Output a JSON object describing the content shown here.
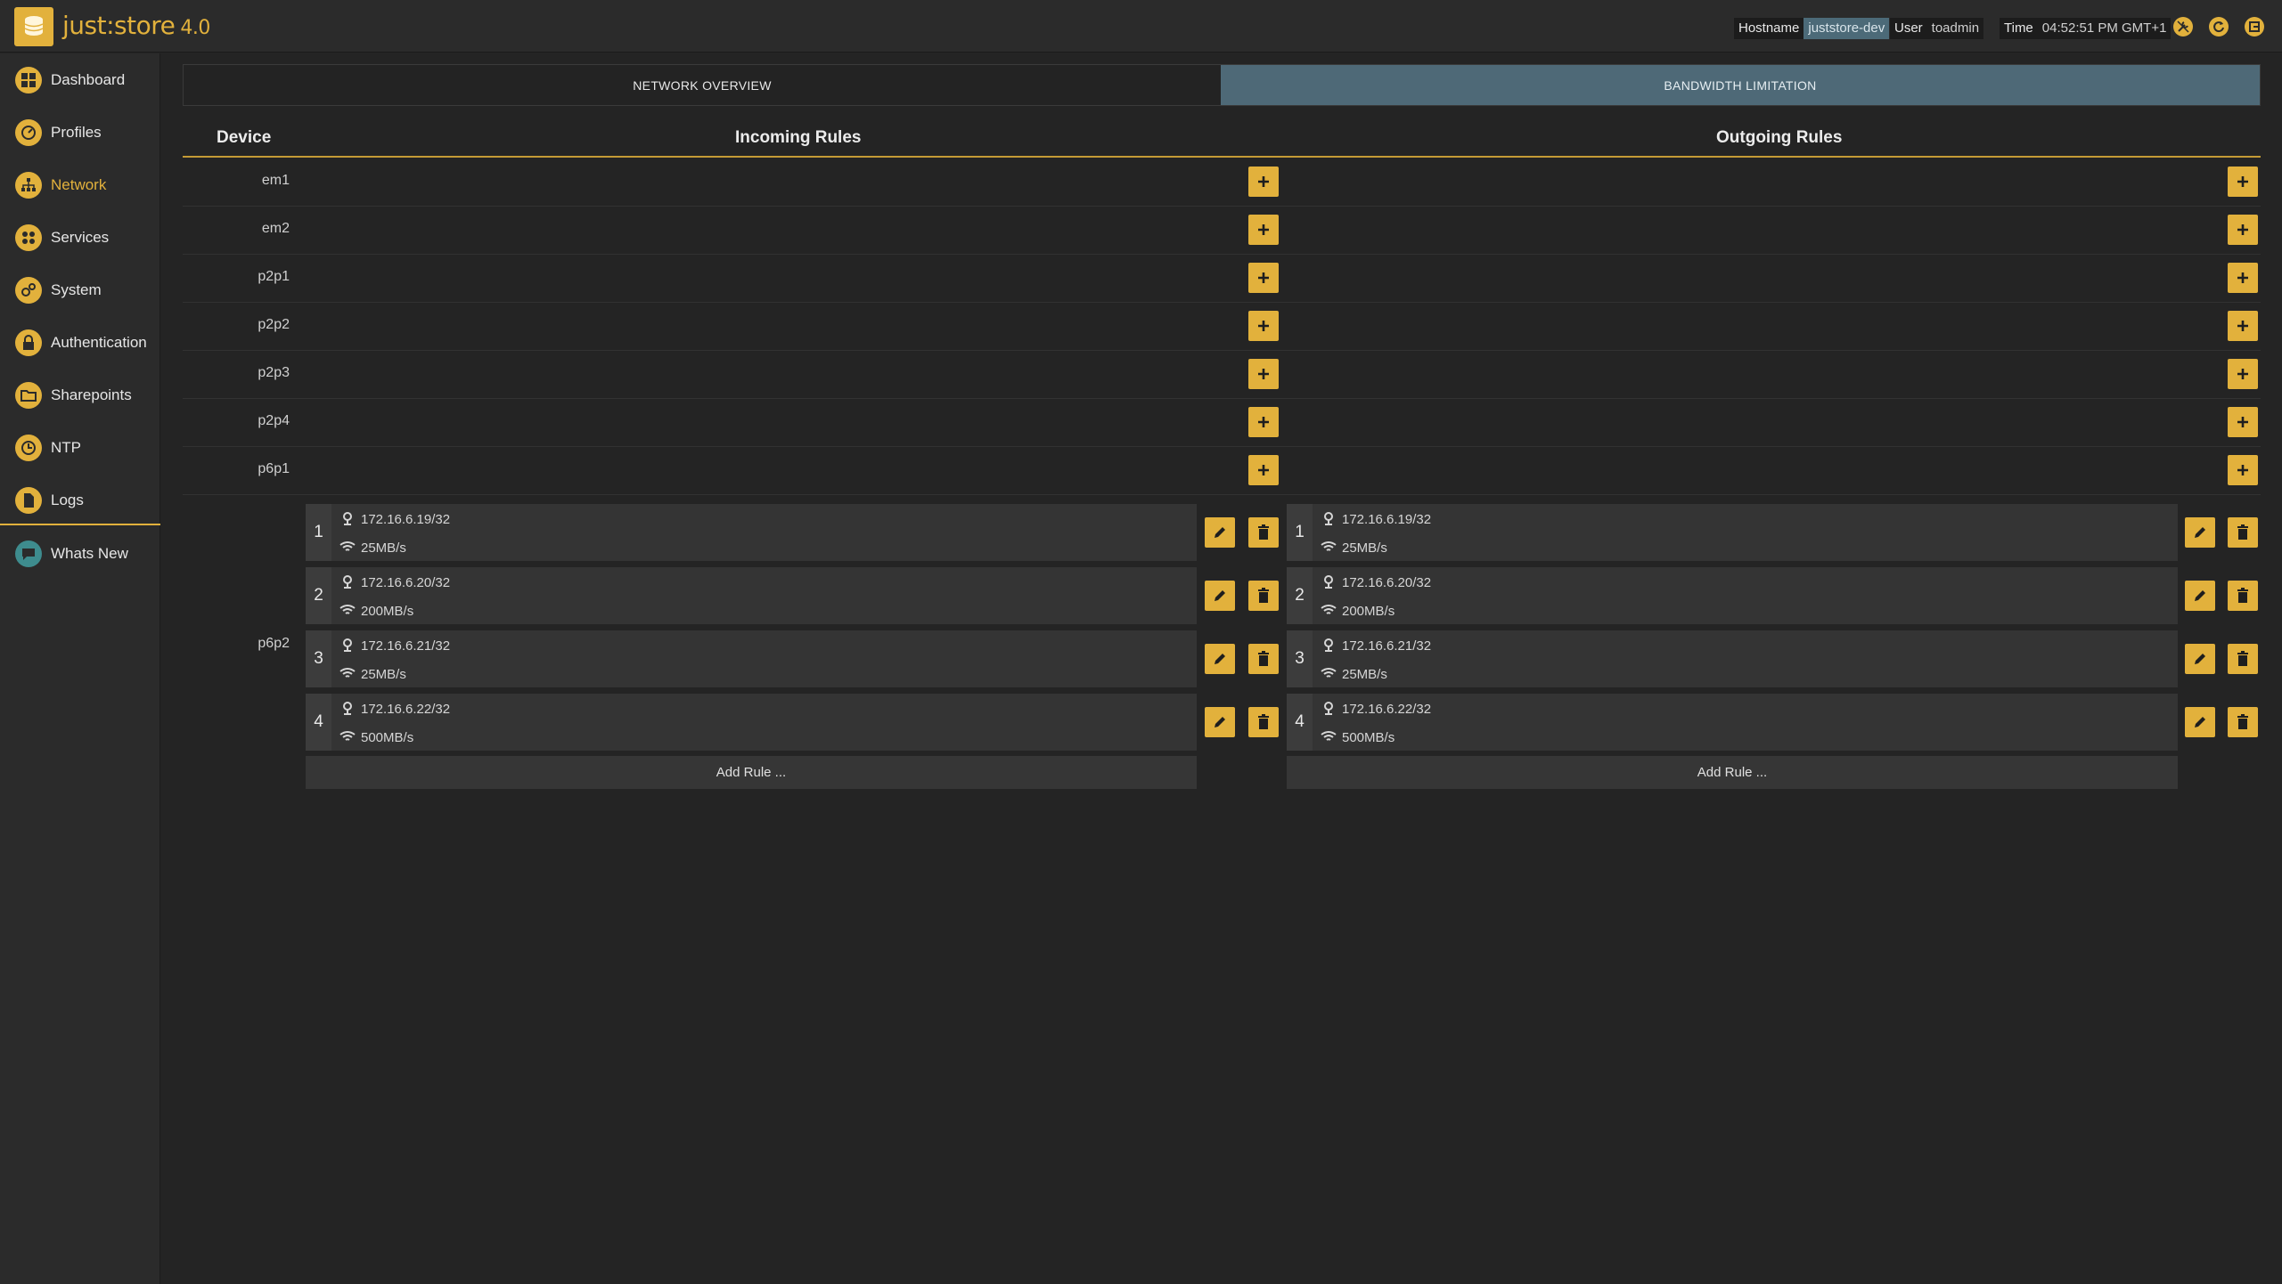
{
  "app": {
    "logo_text": "just:store",
    "version": "4.0"
  },
  "topbar": {
    "hostname_label": "Hostname",
    "hostname_value": "juststore-dev",
    "user_label": "User",
    "user_value": "toadmin",
    "time_label": "Time",
    "time_value": "04:52:51 PM GMT+1",
    "icons": [
      "wrench-icon",
      "refresh-icon",
      "logout-icon"
    ]
  },
  "sidebar": {
    "items": [
      {
        "label": "Dashboard",
        "icon": "dashboard-icon"
      },
      {
        "label": "Profiles",
        "icon": "gauge-icon"
      },
      {
        "label": "Network",
        "icon": "network-icon",
        "active": true
      },
      {
        "label": "Services",
        "icon": "services-icon"
      },
      {
        "label": "System",
        "icon": "gears-icon"
      },
      {
        "label": "Authentication",
        "icon": "lock-icon"
      },
      {
        "label": "Sharepoints",
        "icon": "folder-icon"
      },
      {
        "label": "NTP",
        "icon": "clock-icon"
      },
      {
        "label": "Logs",
        "icon": "file-icon"
      },
      {
        "label": "Whats New",
        "icon": "chat-icon"
      }
    ]
  },
  "tabs": {
    "overview": "NETWORK OVERVIEW",
    "bandwidth": "BANDWIDTH LIMITATION",
    "active": "bandwidth"
  },
  "table": {
    "headers": {
      "device": "Device",
      "incoming": "Incoming Rules",
      "outgoing": "Outgoing Rules"
    },
    "devices": [
      "em1",
      "em2",
      "p2p1",
      "p2p2",
      "p2p3",
      "p2p4",
      "p6p1",
      "p6p2"
    ],
    "p6p2_incoming": [
      {
        "num": "1",
        "ip": "172.16.6.19/32",
        "bandwidth": "25MB/s"
      },
      {
        "num": "2",
        "ip": "172.16.6.20/32",
        "bandwidth": "200MB/s"
      },
      {
        "num": "3",
        "ip": "172.16.6.21/32",
        "bandwidth": "25MB/s"
      },
      {
        "num": "4",
        "ip": "172.16.6.22/32",
        "bandwidth": "500MB/s"
      }
    ],
    "p6p2_outgoing": [
      {
        "num": "1",
        "ip": "172.16.6.19/32",
        "bandwidth": "25MB/s"
      },
      {
        "num": "2",
        "ip": "172.16.6.20/32",
        "bandwidth": "200MB/s"
      },
      {
        "num": "3",
        "ip": "172.16.6.21/32",
        "bandwidth": "25MB/s"
      },
      {
        "num": "4",
        "ip": "172.16.6.22/32",
        "bandwidth": "500MB/s"
      }
    ],
    "add_rule_label": "Add Rule ..."
  },
  "colors": {
    "accent": "#e2b13c",
    "active_tab": "#4e6977",
    "background": "#242424"
  }
}
